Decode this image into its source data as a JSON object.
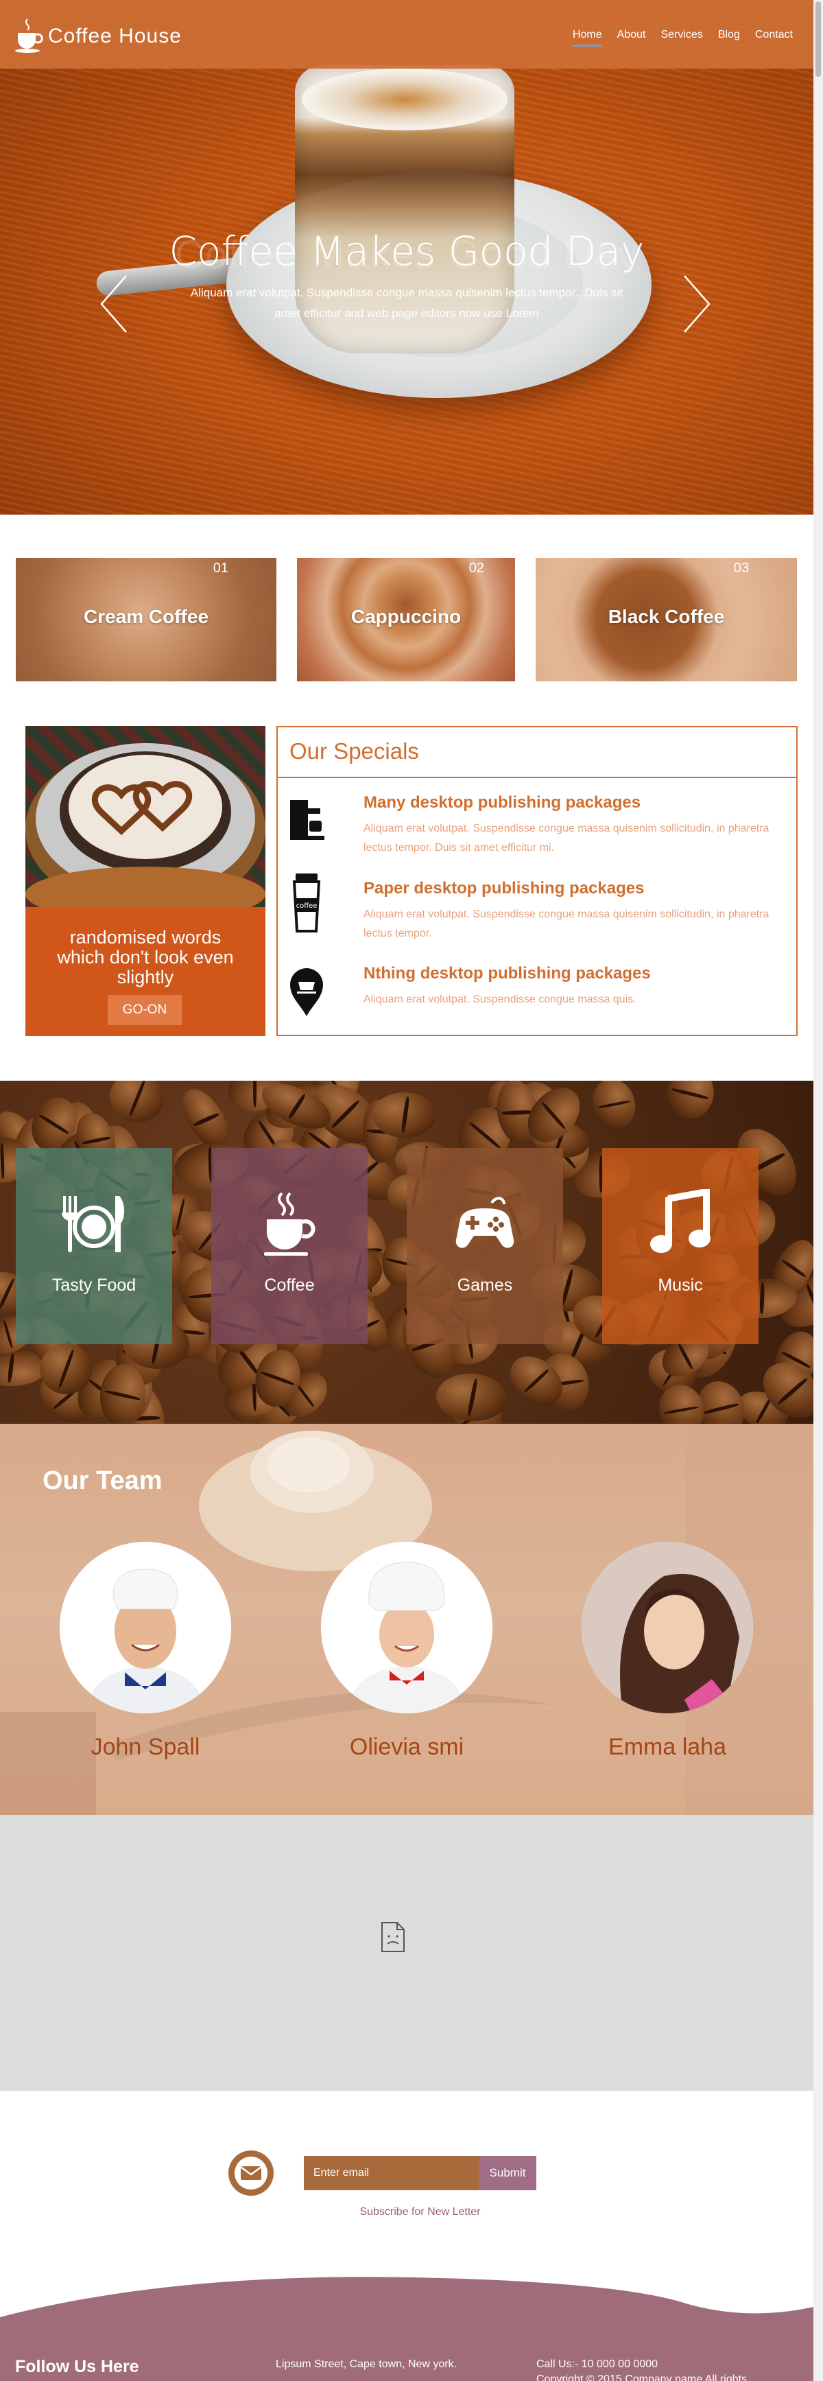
{
  "header": {
    "brand": "Coffee House",
    "nav": [
      "Home",
      "About",
      "Services",
      "Blog",
      "Contact"
    ],
    "active_nav": "Home"
  },
  "hero": {
    "title": "Coffee Makes Good Day",
    "subtitle": "Aliquam erat volutpat. Suspendisse congue massa quisenim lectus tempor.. Duis sit amet efficitur and web page editors now use Lorem",
    "prev_icon": "chevron-left-icon",
    "next_icon": "chevron-right-icon"
  },
  "coffee_cards": [
    {
      "number": "01",
      "label": "Cream Coffee"
    },
    {
      "number": "02",
      "label": "Cappuccino"
    },
    {
      "number": "03",
      "label": "Black Coffee"
    }
  ],
  "promo": {
    "text": "randomised words which don't look even slightly",
    "button": "GO-ON"
  },
  "specials": {
    "title": "Our Specials",
    "items": [
      {
        "icon": "coffee-machine-icon",
        "title": "Many desktop publishing packages",
        "text": "Aliquam erat volutpat. Suspendisse congue massa quisenim sollicitudin, in pharetra lectus tempor. Duis sit amet efficitur mi."
      },
      {
        "icon": "coffee-cup-icon",
        "title": "Paper desktop publishing packages",
        "text": "Aliquam erat volutpat. Suspendisse congue massa quisenim sollicitudin, in pharetra lectus tempor."
      },
      {
        "icon": "location-pin-icon",
        "title": "Nthing desktop publishing packages",
        "text": "Aliquam erat volutpat. Suspendisse congue massa quis."
      }
    ]
  },
  "services": [
    {
      "icon": "fork-plate-knife-icon",
      "label": "Tasty Food",
      "color": "#4e7f6c"
    },
    {
      "icon": "steaming-cup-icon",
      "label": "Coffee",
      "color": "#7b4a5e"
    },
    {
      "icon": "gamepad-icon",
      "label": "Games",
      "color": "#8d5331"
    },
    {
      "icon": "music-note-icon",
      "label": "Music",
      "color": "#b8571c"
    }
  ],
  "team": {
    "title": "Our Team",
    "members": [
      "John Spall",
      "Olievia smi",
      "Emma laha"
    ]
  },
  "map": {
    "icon": "broken-document-icon"
  },
  "newsletter": {
    "email_placeholder": "Enter email",
    "submit": "Submit",
    "label": "Subscribe for New Letter"
  },
  "footer": {
    "follow": "Follow Us Here",
    "address": "Lipsum Street, Cape town, New york.",
    "phone": "Call Us:- 10 000 00 0000",
    "copyright": "Copyright © 2015 Company name All rights"
  },
  "colors": {
    "brand_orange": "#ce6f36",
    "special_orange": "#d06f2f",
    "footer_mauve": "#a06c86",
    "newsletter_brown": "#a86a3a"
  }
}
